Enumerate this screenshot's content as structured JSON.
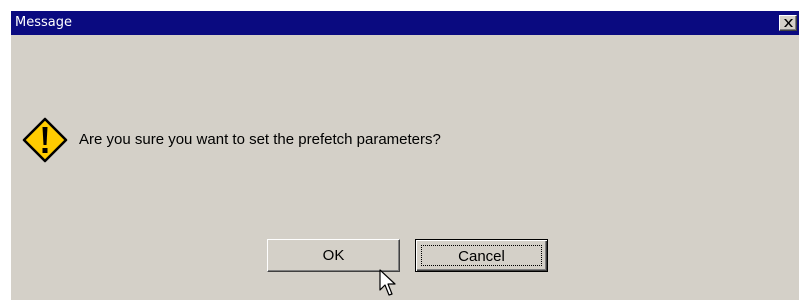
{
  "window": {
    "title": "Message",
    "close_icon": "close-icon"
  },
  "message": {
    "icon": "warning-icon",
    "text": "Are you sure you want to set the prefetch parameters?"
  },
  "buttons": {
    "ok_label": "OK",
    "cancel_label": "Cancel"
  },
  "colors": {
    "titlebar": "#0a0a80",
    "dialog_bg": "#d4d0c8",
    "warning_yellow": "#ffcc00"
  }
}
